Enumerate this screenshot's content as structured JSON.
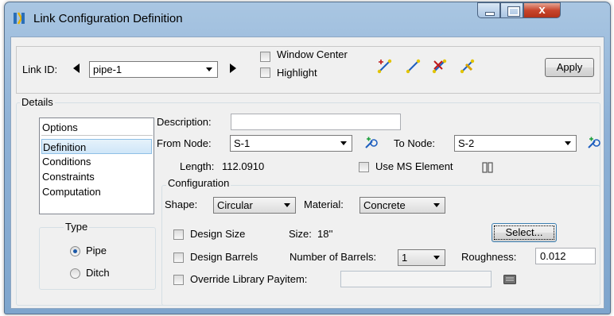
{
  "window": {
    "title": "Link Configuration Definition"
  },
  "titlebar_buttons": {
    "close": "x"
  },
  "toolbar": {
    "link_id_label": "Link ID:",
    "link_id_value": "pipe-1",
    "window_center_label": "Window Center",
    "window_center_checked": false,
    "highlight_label": "Highlight",
    "highlight_checked": false,
    "apply_label": "Apply",
    "tool_icons": [
      "add-link-icon",
      "select-link-icon",
      "delete-link-icon",
      "edit-link-icon"
    ]
  },
  "details": {
    "group_label": "Details",
    "options": {
      "header": "Options",
      "items": [
        "Definition",
        "Conditions",
        "Constraints",
        "Computation"
      ],
      "selected": "Definition"
    },
    "type": {
      "label": "Type",
      "items": [
        "Pipe",
        "Ditch"
      ],
      "selected": "Pipe"
    },
    "description_label": "Description:",
    "description_value": "",
    "from_node_label": "From Node:",
    "from_node_value": "S-1",
    "to_node_label": "To Node:",
    "to_node_value": "S-2",
    "length_label": "Length:",
    "length_value": "112.0910",
    "use_ms_element_label": "Use MS Element",
    "use_ms_element_checked": false,
    "configuration": {
      "label": "Configuration",
      "shape_label": "Shape:",
      "shape_value": "Circular",
      "material_label": "Material:",
      "material_value": "Concrete",
      "design_size_label": "Design Size",
      "design_size_checked": false,
      "size_label": "Size:",
      "size_value": "18''",
      "select_label": "Select...",
      "design_barrels_label": "Design Barrels",
      "design_barrels_checked": false,
      "number_of_barrels_label": "Number of Barrels:",
      "number_of_barrels_value": "1",
      "roughness_label": "Roughness:",
      "roughness_value": "0.012",
      "override_payitem_label": "Override Library Payitem:",
      "override_payitem_checked": false,
      "override_payitem_value": ""
    }
  },
  "colors": {
    "accent": "#1b59a8",
    "title_bar": "#8eb1d6",
    "close_button": "#c8452c"
  }
}
